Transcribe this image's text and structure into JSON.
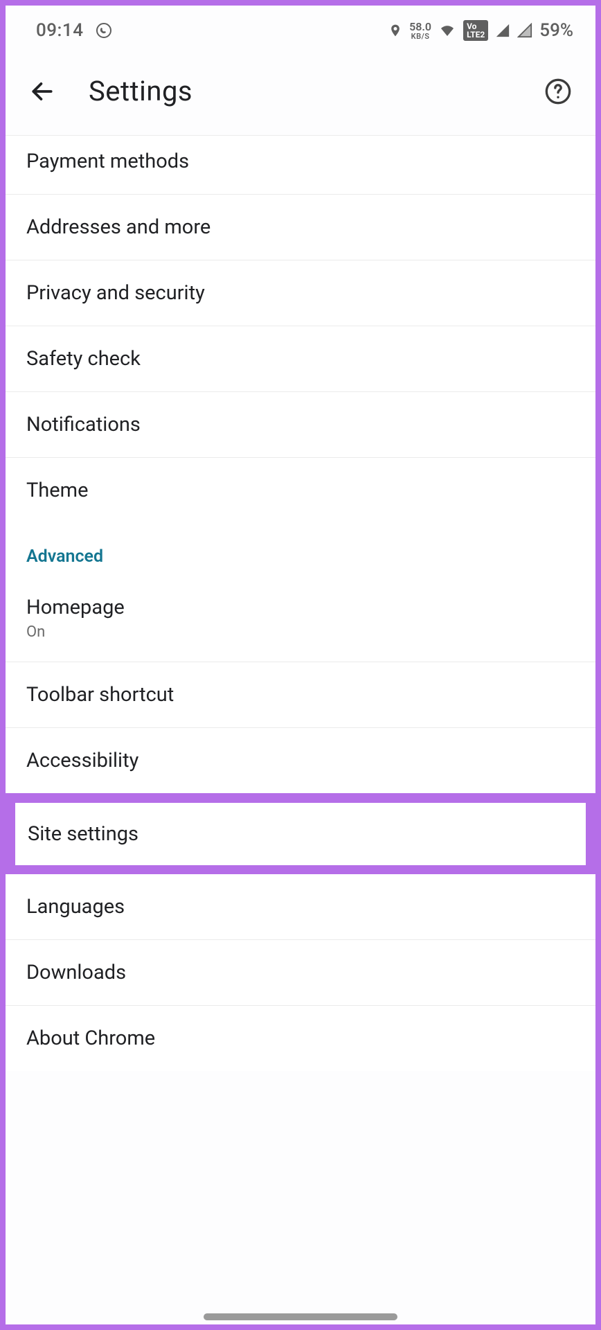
{
  "status": {
    "time": "09:14",
    "data_rate_top": "58.0",
    "data_rate_bottom": "KB/S",
    "volte": "VoLTE2",
    "battery": "59%"
  },
  "header": {
    "title": "Settings"
  },
  "items": [
    {
      "label": "Payment methods"
    },
    {
      "label": "Addresses and more"
    },
    {
      "label": "Privacy and security"
    },
    {
      "label": "Safety check"
    },
    {
      "label": "Notifications"
    },
    {
      "label": "Theme"
    }
  ],
  "section": {
    "title": "Advanced"
  },
  "advanced": [
    {
      "label": "Homepage",
      "sub": "On"
    },
    {
      "label": "Toolbar shortcut"
    },
    {
      "label": "Accessibility"
    },
    {
      "label": "Site settings",
      "highlight": true
    },
    {
      "label": "Languages"
    },
    {
      "label": "Downloads"
    },
    {
      "label": "About Chrome"
    }
  ]
}
